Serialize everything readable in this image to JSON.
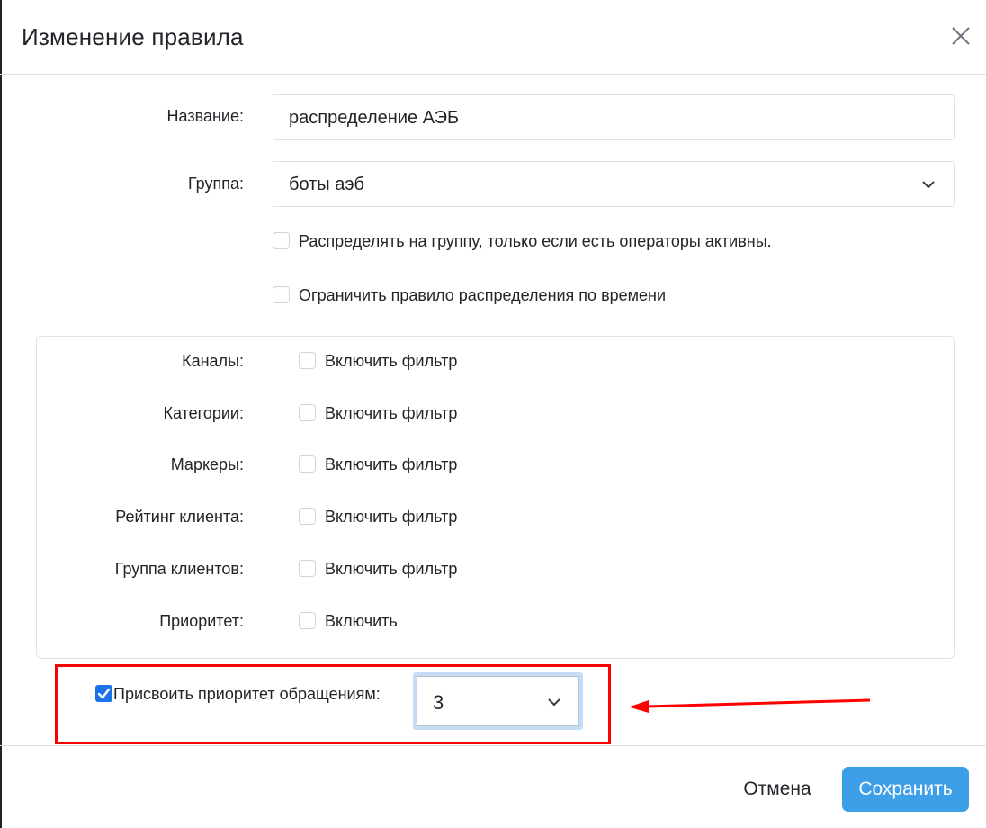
{
  "dialog": {
    "title": "Изменение правила"
  },
  "form": {
    "name_label": "Название:",
    "name_value": "распределение АЭБ",
    "group_label": "Группа:",
    "group_value": "боты аэб",
    "only_active_label": "Распределять на группу, только если есть операторы активны.",
    "limit_time_label": "Ограничить правило распределения по времени"
  },
  "filters": [
    {
      "label": "Каналы:",
      "checkbox_label": "Включить фильтр"
    },
    {
      "label": "Категории:",
      "checkbox_label": "Включить фильтр"
    },
    {
      "label": "Маркеры:",
      "checkbox_label": "Включить фильтр"
    },
    {
      "label": "Рейтинг клиента:",
      "checkbox_label": "Включить фильтр"
    },
    {
      "label": "Группа клиентов:",
      "checkbox_label": "Включить фильтр"
    },
    {
      "label": "Приоритет:",
      "checkbox_label": "Включить"
    }
  ],
  "assign_priority": {
    "label": "Присвоить приоритет обращениям:",
    "checked": true,
    "value": "3"
  },
  "footer": {
    "cancel_label": "Отмена",
    "save_label": "Сохранить"
  },
  "colors": {
    "accent": "#3d9fe8",
    "checkbox_checked": "#1a73e8",
    "annotation": "#ff0000"
  }
}
